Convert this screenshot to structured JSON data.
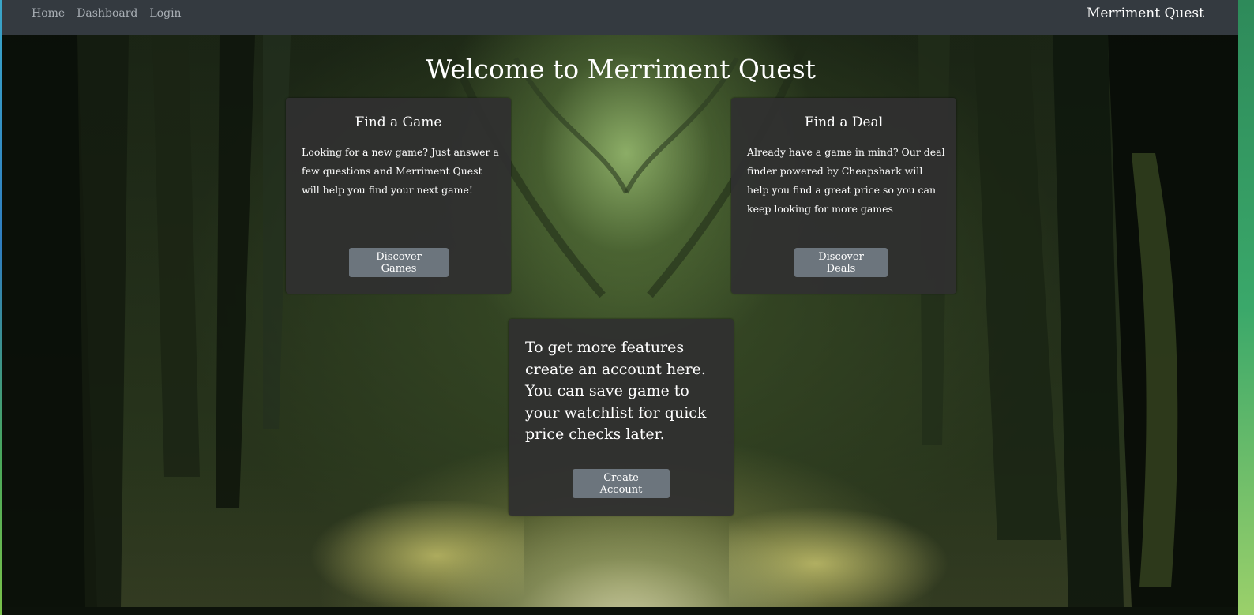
{
  "navbar": {
    "links": [
      "Home",
      "Dashboard",
      "Login"
    ],
    "brand": "Merriment Quest"
  },
  "main": {
    "title": "Welcome to Merriment Quest",
    "cards": [
      {
        "title": "Find a Game",
        "text": "Looking for a new game? Just answer a few questions and Merriment Quest will help you find your next game!",
        "button": "Discover Games"
      },
      {
        "title": "Find a Deal",
        "text": "Already have a game in mind? Our deal finder powered by Cheapshark will help you find a great price so you can keep looking for more games",
        "button": "Discover Deals"
      }
    ],
    "account": {
      "text": "To get more features create an account here. You can save game to your watchlist for quick price checks later.",
      "button": "Create Account"
    }
  },
  "colors": {
    "navbar": "#343a40",
    "card": "#303030",
    "button": "#6c757d",
    "nav_link": "#a9afb5"
  }
}
